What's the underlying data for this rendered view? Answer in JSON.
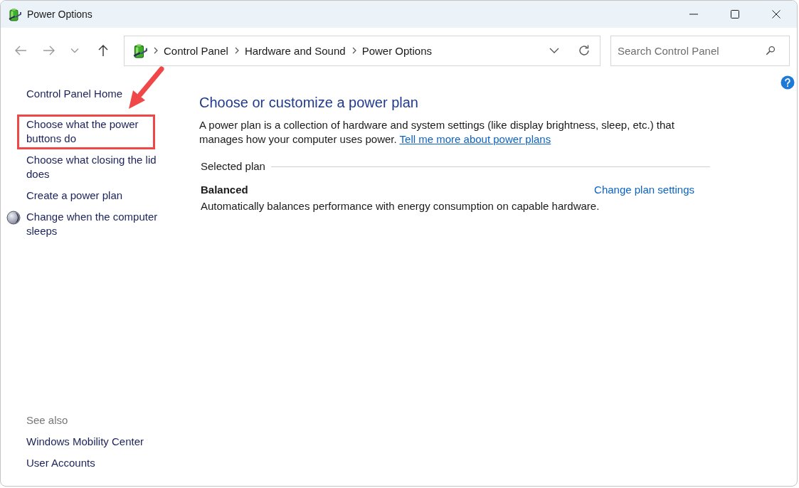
{
  "window": {
    "title": "Power Options"
  },
  "navigation": {
    "buttons": [
      {
        "kind": "back",
        "disabled": true
      },
      {
        "kind": "forward",
        "disabled": true
      },
      {
        "kind": "recent",
        "disabled": true
      },
      {
        "kind": "up",
        "disabled": false
      }
    ],
    "address_bar": {
      "breadcrumbs": [
        "Control Panel",
        "Hardware and Sound",
        "Power Options"
      ]
    },
    "search": {
      "placeholder": "Search Control Panel"
    }
  },
  "sidebar": {
    "tasks": [
      {
        "label": "Control Panel Home",
        "kind": "link",
        "highlighted": false
      },
      {
        "label": "Choose what the power buttons do",
        "kind": "link",
        "highlighted": true
      },
      {
        "label": "Choose what closing the lid does",
        "kind": "link",
        "highlighted": false
      },
      {
        "label": "Create a power plan",
        "kind": "link",
        "highlighted": false
      },
      {
        "label": "Change when the computer sleeps",
        "kind": "icon_link",
        "highlighted": false
      }
    ],
    "see_also": {
      "heading": "See also",
      "links": [
        "Windows Mobility Center",
        "User Accounts"
      ]
    }
  },
  "main": {
    "heading": "Choose or customize a power plan",
    "description": "A power plan is a collection of hardware and system settings (like display brightness, sleep, etc.) that manages how your computer uses power.",
    "link": "Tell me more about power plans",
    "selected_plan": {
      "heading": "Selected plan",
      "name": "Balanced",
      "action": "Change plan settings",
      "description": "Automatically balances performance with energy consumption on capable hardware."
    }
  }
}
